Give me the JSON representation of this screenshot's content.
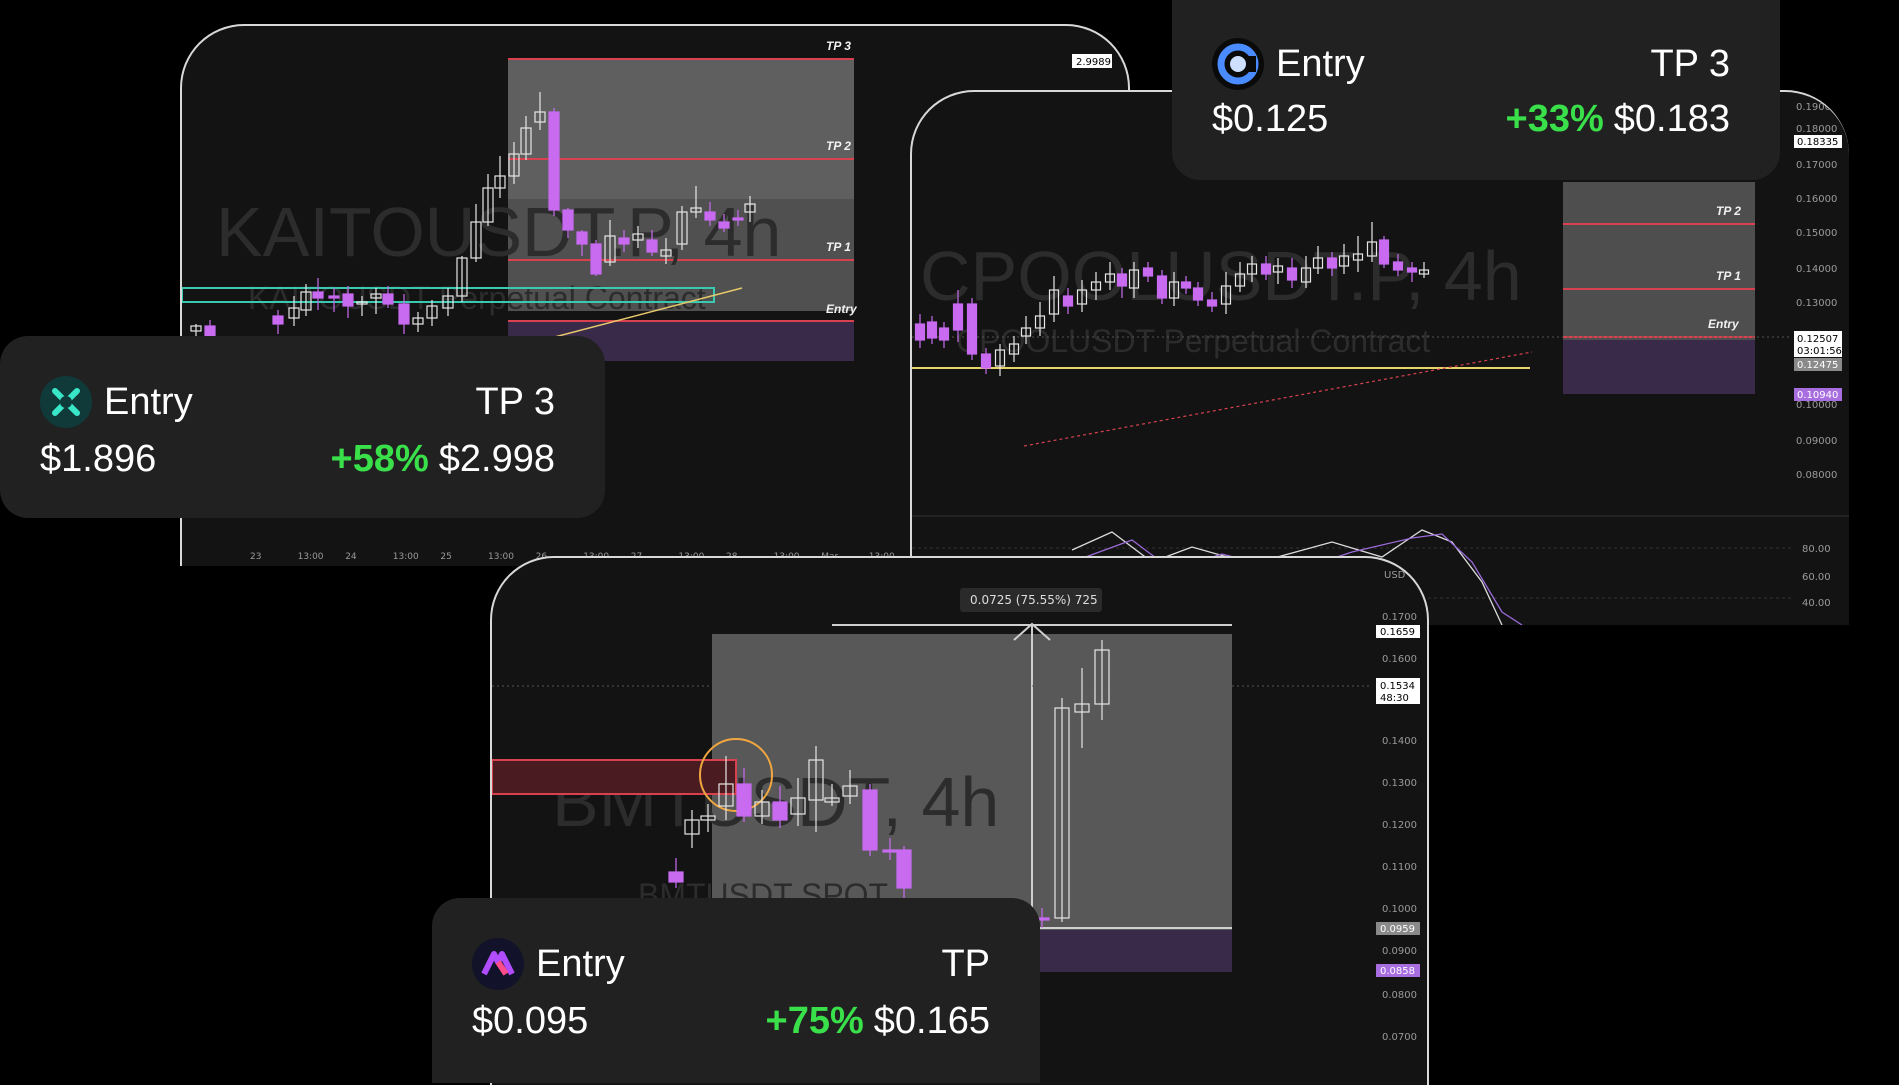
{
  "charts": {
    "kaito": {
      "symbol": "KAITOUSDT.P, 4h",
      "subtitle": "KAITOUSDT Perpetual Contract",
      "levels": {
        "tp3": "TP 3",
        "tp2": "TP 2",
        "tp1": "TP 1",
        "entry": "Entry"
      },
      "price_tag": "2.9989",
      "time_axis": [
        "23",
        "13:00",
        "24",
        "13:00",
        "25",
        "13:00",
        "26",
        "13:00",
        "27",
        "13:00",
        "28",
        "13:00",
        "Mar",
        "13:00"
      ]
    },
    "cpool": {
      "symbol": "CPOOLUSDT.P, 4h",
      "subtitle": "CPOOLUSDT Perpetual Contract",
      "levels": {
        "tp2": "TP 2",
        "tp1": "TP 1",
        "entry": "Entry"
      },
      "price_axis": [
        "0.19000",
        "0.18000",
        "0.17000",
        "0.16000",
        "0.15000",
        "0.14000",
        "0.13000",
        "0.10000",
        "0.09000",
        "0.08000"
      ],
      "price_tags": {
        "top": "0.18335",
        "current": "0.12507",
        "countdown": "03:01:56",
        "entry": "0.12475",
        "low": "0.10940"
      },
      "oscillator_axis": [
        "80.00",
        "60.00",
        "40.00"
      ]
    },
    "bmt": {
      "symbol": "BMTUSDT, 4h",
      "subtitle": "BMTUSDT SPOT",
      "measure_label": "0.0725 (75.55%) 725",
      "currency": "USD",
      "price_axis": [
        "0.1700",
        "0.1600",
        "0.1400",
        "0.1300",
        "0.1200",
        "0.1100",
        "0.1000",
        "0.0900",
        "0.0800",
        "0.0700"
      ],
      "price_tags": {
        "top": "0.1659",
        "current": "0.1534",
        "countdown": "48:30",
        "entry": "0.0959",
        "low": "0.0858"
      }
    }
  },
  "cards": {
    "kaito": {
      "entry_label": "Entry",
      "tp_label": "TP 3",
      "entry_price": "$1.896",
      "gain": "+58%",
      "tp_price": "$2.998",
      "icon": "kaito-coin-icon",
      "color": "#39e6c8"
    },
    "cpool": {
      "entry_label": "Entry",
      "tp_label": "TP 3",
      "entry_price": "$0.125",
      "gain": "+33%",
      "tp_price": "$0.183",
      "icon": "cpool-coin-icon",
      "color": "#4a8cff"
    },
    "bmt": {
      "entry_label": "Entry",
      "tp_label": "TP",
      "entry_price": "$0.095",
      "gain": "+75%",
      "tp_price": "$0.165",
      "icon": "bmt-coin-icon",
      "color": "#b14cff"
    }
  },
  "colors": {
    "gain": "#39e04a",
    "bull": "#ffffff",
    "bear": "#c86bf0",
    "tp_line": "#d9414f",
    "zone": "#5a5a5a",
    "entry_zone": "#3a2a4a"
  }
}
